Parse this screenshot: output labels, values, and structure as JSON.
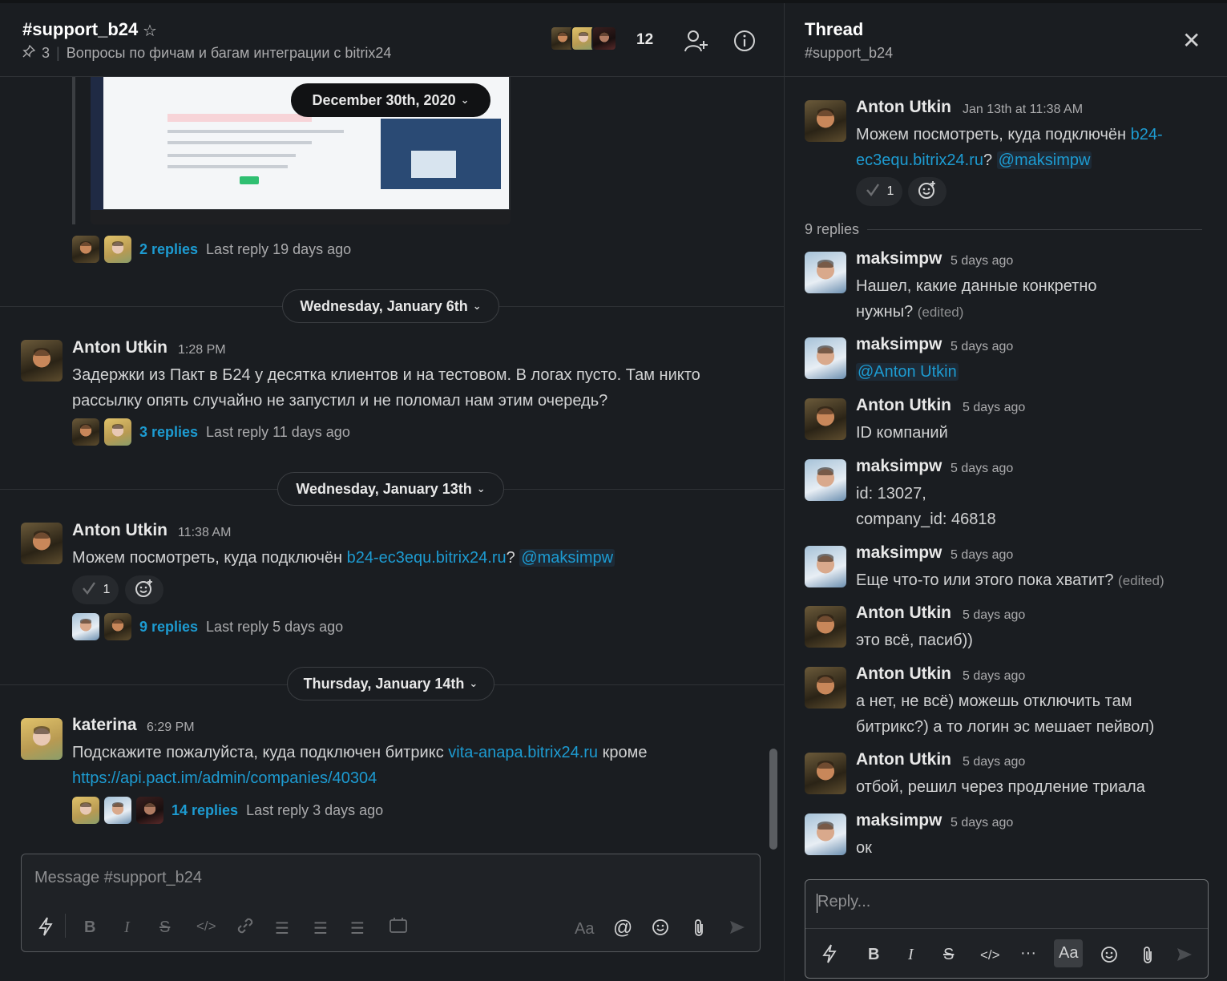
{
  "channel": {
    "name": "#support_b24",
    "pins": "3",
    "topic": "Вопросы по фичам и багам интеграции с bitrix24",
    "member_count": "12"
  },
  "embed_date": "December 30th, 2020",
  "thread_summary_1": {
    "count": "2 replies",
    "last": "Last reply 19 days ago"
  },
  "day1": "Wednesday, January 6th",
  "msg1": {
    "author": "Anton Utkin",
    "time": "1:28 PM",
    "line1": "Задержки из Пакт в Б24 у десятка клиентов и на тестовом. В логах пусто. Там никто",
    "line2": "рассылку опять случайно не запустил и не поломал нам этим очередь?",
    "replies": "3 replies",
    "last": "Last reply 11 days ago"
  },
  "day2": "Wednesday, January 13th",
  "msg2": {
    "author": "Anton Utkin",
    "time": "11:38 AM",
    "prefix": "Можем посмотреть, куда подключён ",
    "link": "b24-ec3equ.bitrix24.ru",
    "q": "? ",
    "mention": "@maksimpw",
    "reaction_count": "1",
    "replies": "9 replies",
    "last": "Last reply 5 days ago"
  },
  "day3": "Thursday, January 14th",
  "msg3": {
    "author": "katerina",
    "time": "6:29 PM",
    "prefix": "Подскажите пожалуйста, куда подключен битрикс ",
    "link1": "vita-anapa.bitrix24.ru",
    "mid": " кроме",
    "link2": "https://api.pact.im/admin/companies/40304",
    "replies": "14 replies",
    "last": "Last reply 3 days ago"
  },
  "composer": {
    "placeholder": "Message #support_b24",
    "aa": "Aa"
  },
  "thread": {
    "title": "Thread",
    "channel": "#support_b24",
    "parent": {
      "author": "Anton Utkin",
      "time": "Jan 13th at 11:38 AM",
      "prefix": "Можем посмотреть, куда подключён ",
      "link_a": "b24-",
      "link_b": "ec3equ.bitrix24.ru",
      "q": "? ",
      "mention": "@maksimpw",
      "reaction_count": "1"
    },
    "replies_label": "9 replies",
    "edited": "(edited)",
    "replies": [
      {
        "author": "maksimpw",
        "time": "5 days ago",
        "l1": "Нашел, какие данные конкретно",
        "l2": "нужны?"
      },
      {
        "author": "maksimpw",
        "time": "5 days ago",
        "l1": "@Anton Utkin"
      },
      {
        "author": "Anton Utkin",
        "time": "5 days ago",
        "l1": "ID компаний"
      },
      {
        "author": "maksimpw",
        "time": "5 days ago",
        "l1": "id: 13027,",
        "l2": "company_id: 46818"
      },
      {
        "author": "maksimpw",
        "time": "5 days ago",
        "l1": "Еще что-то или этого пока хватит?"
      },
      {
        "author": "Anton Utkin",
        "time": "5 days ago",
        "l1": "это всё, пасиб))"
      },
      {
        "author": "Anton Utkin",
        "time": "5 days ago",
        "l1": "а нет, не всё) можешь отключить там",
        "l2": "битрикс?) а то логин эс мешает пейвол)"
      },
      {
        "author": "Anton Utkin",
        "time": "5 days ago",
        "l1": "отбой, решил через продление триала"
      },
      {
        "author": "maksimpw",
        "time": "5 days ago",
        "l1": "ок"
      }
    ],
    "reply_placeholder": "Reply...",
    "aa": "Aa"
  },
  "icons": [
    "star-icon",
    "pin-icon",
    "add-member-icon",
    "info-icon",
    "close-icon",
    "chevron-down-icon",
    "checkmark-icon",
    "add-reaction-icon",
    "lightning-icon",
    "bold-icon",
    "italic-icon",
    "strike-icon",
    "code-icon",
    "link-icon",
    "ordered-list-icon",
    "bullet-list-icon",
    "blockquote-icon",
    "code-block-icon",
    "mention-icon",
    "emoji-icon",
    "attach-icon",
    "send-icon",
    "more-icon"
  ]
}
